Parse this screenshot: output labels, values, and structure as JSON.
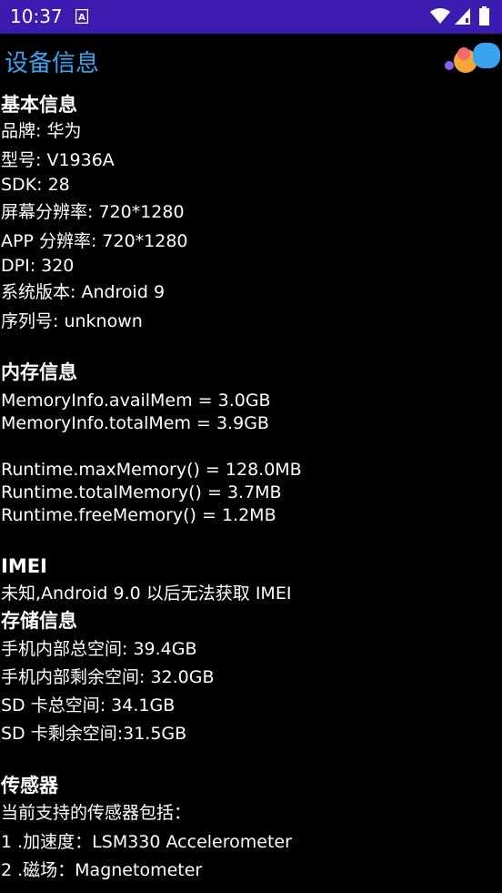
{
  "status_bar": {
    "time": "10:37",
    "notification_icon": "a-icon",
    "colors": {
      "background": "#3b1bb0"
    }
  },
  "app_bar": {
    "title": "设备信息",
    "title_color": "#3aa3f0"
  },
  "basic": {
    "heading": "基本信息",
    "brand": "品牌: 华为",
    "model": "型号: V1936A",
    "sdk": "SDK:  28",
    "screen_resolution": "屏幕分辨率: 720*1280",
    "app_resolution": "APP 分辨率: 720*1280",
    "dpi": "DPI: 320",
    "os_version": "系统版本: Android 9",
    "serial": "序列号: unknown"
  },
  "memory": {
    "heading": "内存信息",
    "avail_mem": "MemoryInfo.availMem = 3.0GB",
    "total_mem": "MemoryInfo.totalMem = 3.9GB",
    "runtime_max": "Runtime.maxMemory() = 128.0MB",
    "runtime_total": "Runtime.totalMemory() = 3.7MB",
    "runtime_free": "Runtime.freeMemory() = 1.2MB"
  },
  "imei": {
    "heading": "IMEI",
    "value": "未知,Android 9.0 以后无法获取 IMEI"
  },
  "storage": {
    "heading": "存储信息",
    "internal_total": "手机内部总空间: 39.4GB",
    "internal_free": "手机内部剩余空间: 32.0GB",
    "sd_total": "SD 卡总空间: 34.1GB",
    "sd_free": "SD 卡剩余空间:31.5GB"
  },
  "sensors": {
    "heading": "传感器",
    "intro": "当前支持的传感器包括：",
    "items": [
      "1 .加速度：LSM330 Accelerometer",
      "2 .磁场：Magnetometer"
    ]
  }
}
